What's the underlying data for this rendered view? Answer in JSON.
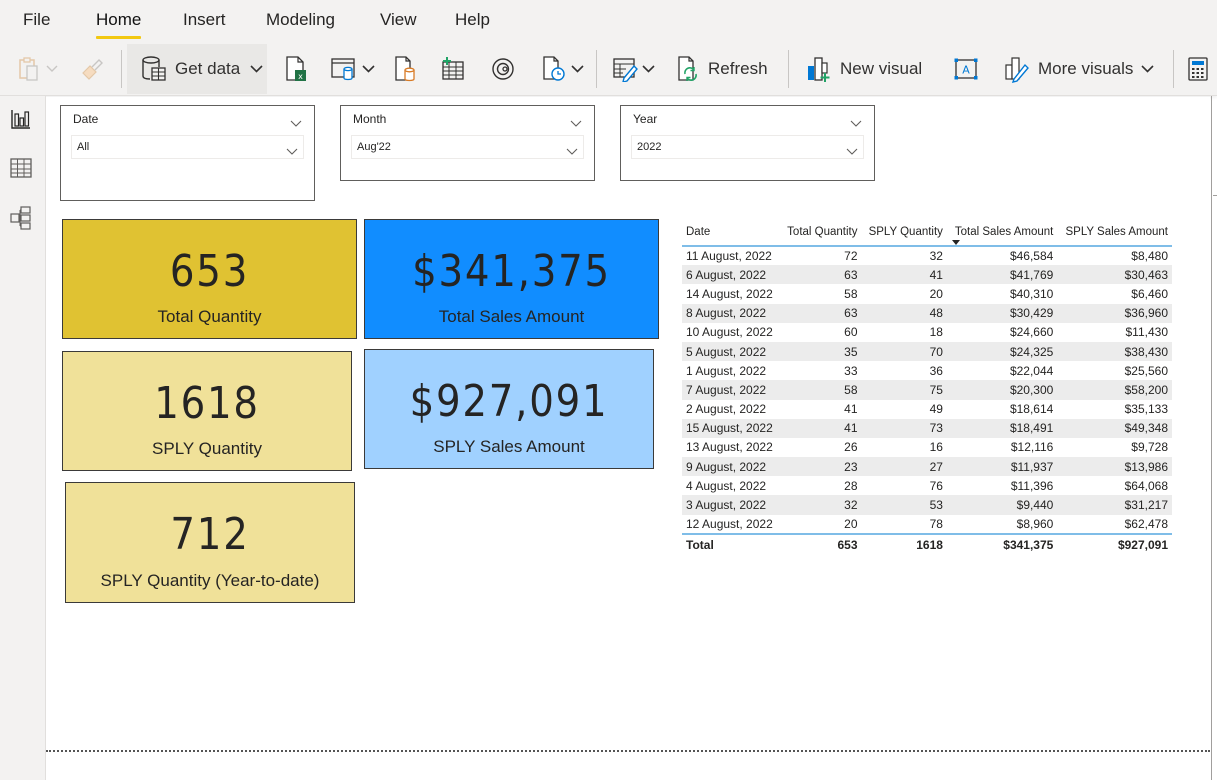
{
  "menu": {
    "tabs": [
      {
        "label": "File"
      },
      {
        "label": "Home",
        "active": true
      },
      {
        "label": "Insert"
      },
      {
        "label": "Modeling"
      },
      {
        "label": "View"
      },
      {
        "label": "Help"
      }
    ],
    "active_underline_color": "#f2c811"
  },
  "toolbar": {
    "paste_icon": "clipboard-paste-icon",
    "format_painter_icon": "format-painter-icon",
    "get_data_label": "Get data",
    "excel_icon": "excel-workbook-icon",
    "data_hub_icon": "data-hub-icon",
    "sql_server_icon": "sql-server-icon",
    "enter_data_icon": "enter-data-icon",
    "dataverse_icon": "dataverse-icon",
    "recent_sources_icon": "recent-sources-icon",
    "transform_data_icon": "transform-data-icon",
    "refresh_label": "Refresh",
    "new_visual_label": "New visual",
    "text_box_icon": "text-box-icon",
    "more_visuals_label": "More visuals",
    "calculator_icon": "new-measure-icon"
  },
  "leftnav": {
    "items": [
      "report-view-icon",
      "data-view-icon",
      "model-view-icon"
    ]
  },
  "slicers": [
    {
      "title": "Date",
      "value": "All"
    },
    {
      "title": "Month",
      "value": "Aug'22"
    },
    {
      "title": "Year",
      "value": "2022"
    }
  ],
  "cards": {
    "total_quantity": {
      "value": "653",
      "label": "Total Quantity",
      "color": "#e0c232"
    },
    "total_sales": {
      "value": "$341,375",
      "label": "Total Sales Amount",
      "color": "#118dff"
    },
    "sply_quantity": {
      "value": "1618",
      "label": "SPLY Quantity",
      "color": "#f0e199"
    },
    "sply_sales": {
      "value": "$927,091",
      "label": "SPLY Sales Amount",
      "color": "#a0d1ff"
    },
    "sply_ytd": {
      "value": "712",
      "label": "SPLY Quantity (Year-to-date)",
      "color": "#f0e199"
    }
  },
  "table": {
    "headers": [
      "Date",
      "Total Quantity",
      "SPLY Quantity",
      "Total Sales Amount",
      "SPLY Sales Amount"
    ],
    "sorted_column": "Total Sales Amount",
    "sort_direction": "descending",
    "rows": [
      [
        "11 August, 2022",
        "72",
        "32",
        "$46,584",
        "$8,480"
      ],
      [
        "6 August, 2022",
        "63",
        "41",
        "$41,769",
        "$30,463"
      ],
      [
        "14 August, 2022",
        "58",
        "20",
        "$40,310",
        "$6,460"
      ],
      [
        "8 August, 2022",
        "63",
        "48",
        "$30,429",
        "$36,960"
      ],
      [
        "10 August, 2022",
        "60",
        "18",
        "$24,660",
        "$11,430"
      ],
      [
        "5 August, 2022",
        "35",
        "70",
        "$24,325",
        "$38,430"
      ],
      [
        "1 August, 2022",
        "33",
        "36",
        "$22,044",
        "$25,560"
      ],
      [
        "7 August, 2022",
        "58",
        "75",
        "$20,300",
        "$58,200"
      ],
      [
        "2 August, 2022",
        "41",
        "49",
        "$18,614",
        "$35,133"
      ],
      [
        "15 August, 2022",
        "41",
        "73",
        "$18,491",
        "$49,348"
      ],
      [
        "13 August, 2022",
        "26",
        "16",
        "$12,116",
        "$9,728"
      ],
      [
        "9 August, 2022",
        "23",
        "27",
        "$11,937",
        "$13,986"
      ],
      [
        "4 August, 2022",
        "28",
        "76",
        "$11,396",
        "$64,068"
      ],
      [
        "3 August, 2022",
        "32",
        "53",
        "$9,440",
        "$31,217"
      ],
      [
        "12 August, 2022",
        "20",
        "78",
        "$8,960",
        "$62,478"
      ]
    ],
    "total": [
      "Total",
      "653",
      "1618",
      "$341,375",
      "$927,091"
    ]
  }
}
